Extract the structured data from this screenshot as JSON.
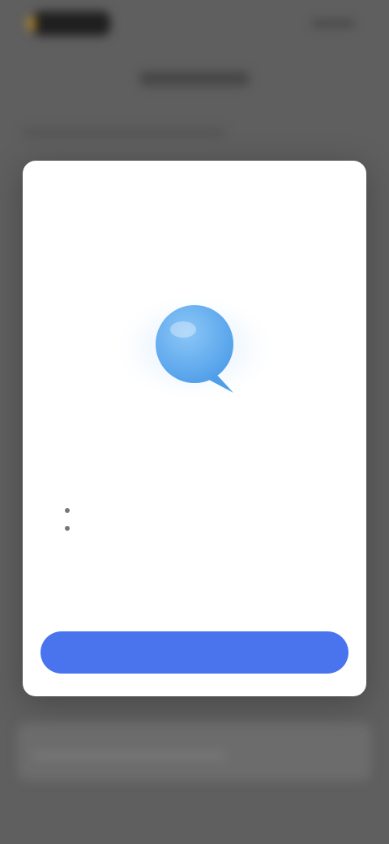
{
  "modal": {
    "title": "",
    "hero_icon": "chat-bubble-icon",
    "feature_heading": "",
    "bullets": [
      "",
      ""
    ],
    "button_label": ""
  },
  "colors": {
    "accent": "#4a74ee",
    "hero_blue": "#5aaaf2",
    "overlay": "#5f5f5f",
    "card": "#ffffff"
  }
}
